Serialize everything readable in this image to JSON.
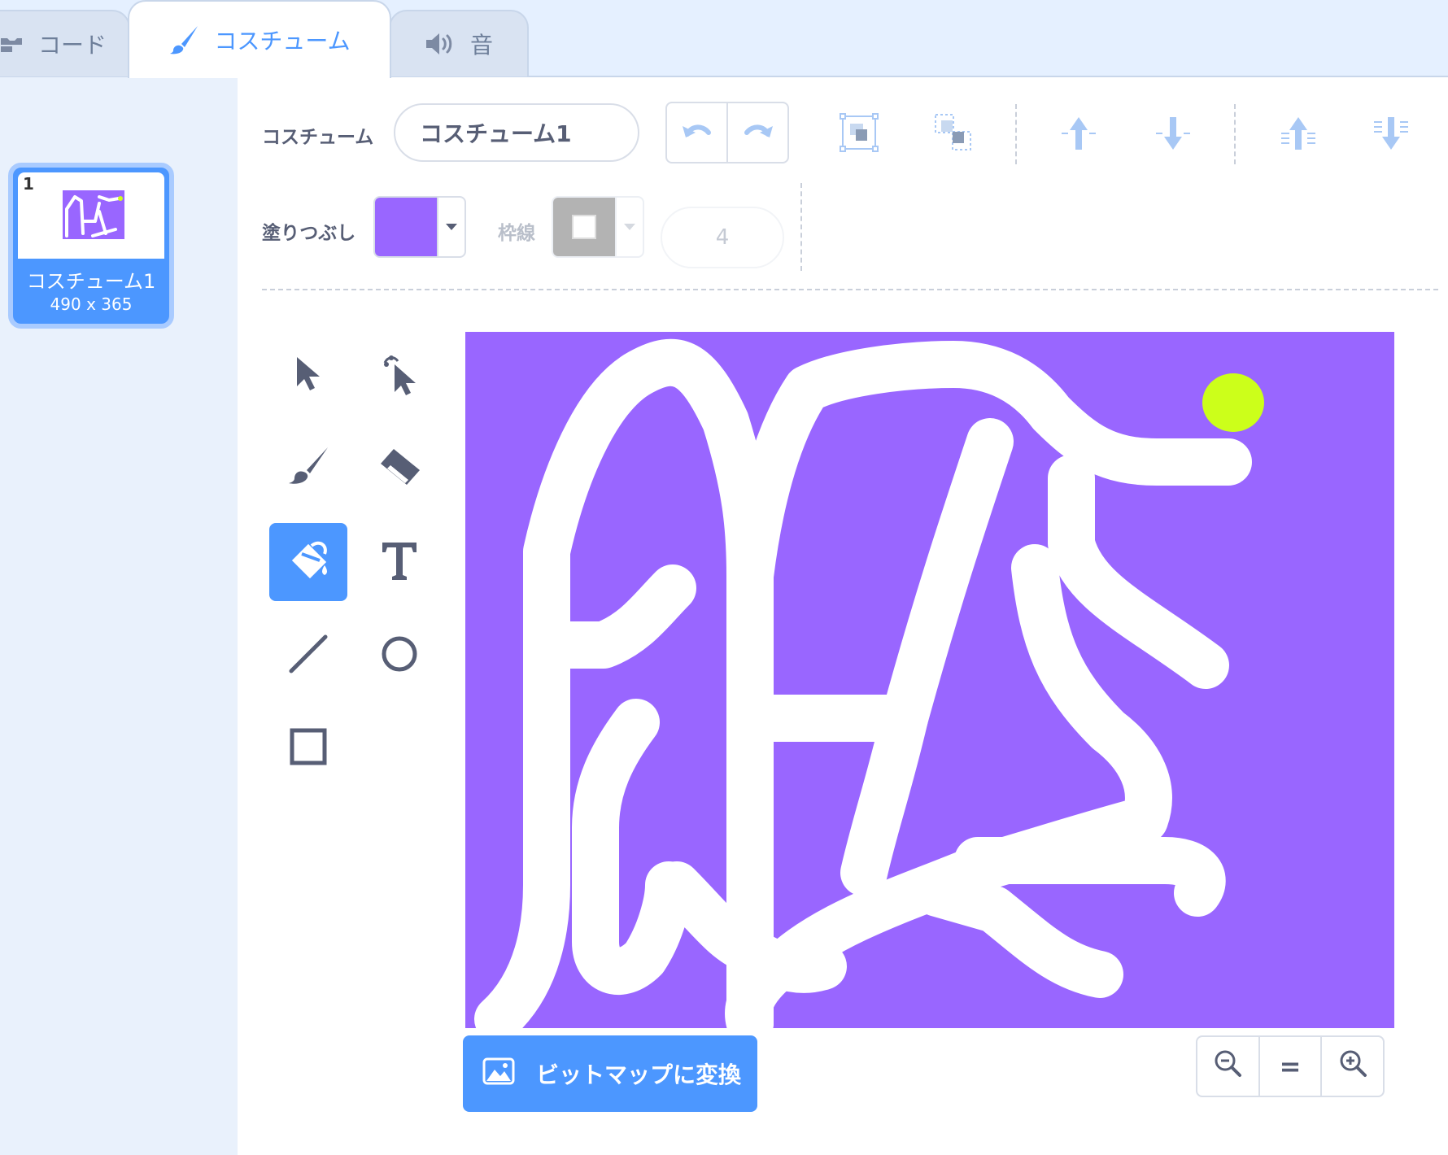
{
  "tabs": [
    {
      "label": "コード",
      "icon": "code-blocks-icon"
    },
    {
      "label": "コスチューム",
      "icon": "paintbrush-icon"
    },
    {
      "label": "音",
      "icon": "speaker-icon"
    }
  ],
  "costume_list": [
    {
      "number": "1",
      "name": "コスチューム1",
      "size": "490 x 365"
    }
  ],
  "toolbar": {
    "costume_label": "コスチューム",
    "costume_name": "コスチューム1",
    "fill_label": "塗りつぶし",
    "outline_label": "枠線",
    "outline_width": "4",
    "fill_color": "#9966ff",
    "outline_color": "#ffffff"
  },
  "tools": [
    {
      "name": "select-tool",
      "icon": "arrow-cursor-icon"
    },
    {
      "name": "reshape-tool",
      "icon": "reshape-cursor-icon"
    },
    {
      "name": "brush-tool",
      "icon": "brush-icon"
    },
    {
      "name": "eraser-tool",
      "icon": "eraser-icon"
    },
    {
      "name": "fill-tool",
      "icon": "paint-bucket-icon",
      "active": true
    },
    {
      "name": "text-tool",
      "icon": "text-icon"
    },
    {
      "name": "line-tool",
      "icon": "line-icon"
    },
    {
      "name": "circle-tool",
      "icon": "circle-icon"
    },
    {
      "name": "rectangle-tool",
      "icon": "rectangle-icon"
    }
  ],
  "canvas": {
    "background_color": "#9966ff",
    "stroke_color": "#ffffff",
    "dot_color": "#ccff1a"
  },
  "convert_button": "ビットマップに変換",
  "zoom": {
    "reset_label": "="
  },
  "colors": {
    "accent": "#4c97ff",
    "text": "#575e75"
  }
}
